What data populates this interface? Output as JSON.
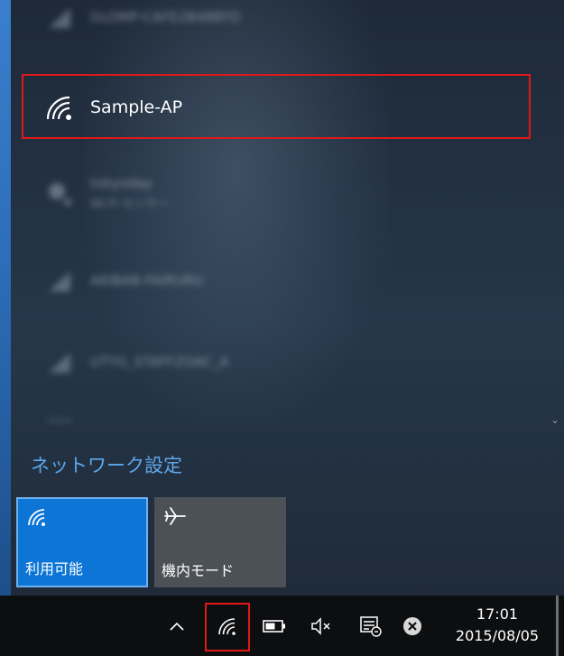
{
  "networks": [
    {
      "label": "GLOMP-CAFE2B48BYD",
      "blurred": true
    },
    {
      "label": "Sample-AP",
      "blurred": false,
      "selected": true
    },
    {
      "label": "tokyoday",
      "sub": "Wi-Fi センサー",
      "blurred": true
    },
    {
      "label": "AKIBAB-FAIRURU",
      "blurred": true
    },
    {
      "label": "UTYG_STAFFZOAC_A",
      "blurred": true
    }
  ],
  "network_settings_label": "ネットワーク設定",
  "quick_actions": {
    "wifi_label": "利用可能",
    "airplane_label": "機内モード"
  },
  "taskbar": {
    "time": "17:01",
    "date": "2015/08/05"
  },
  "colors": {
    "accent": "#0c75d6",
    "highlight": "#e01818",
    "link": "#5ea6ea"
  }
}
